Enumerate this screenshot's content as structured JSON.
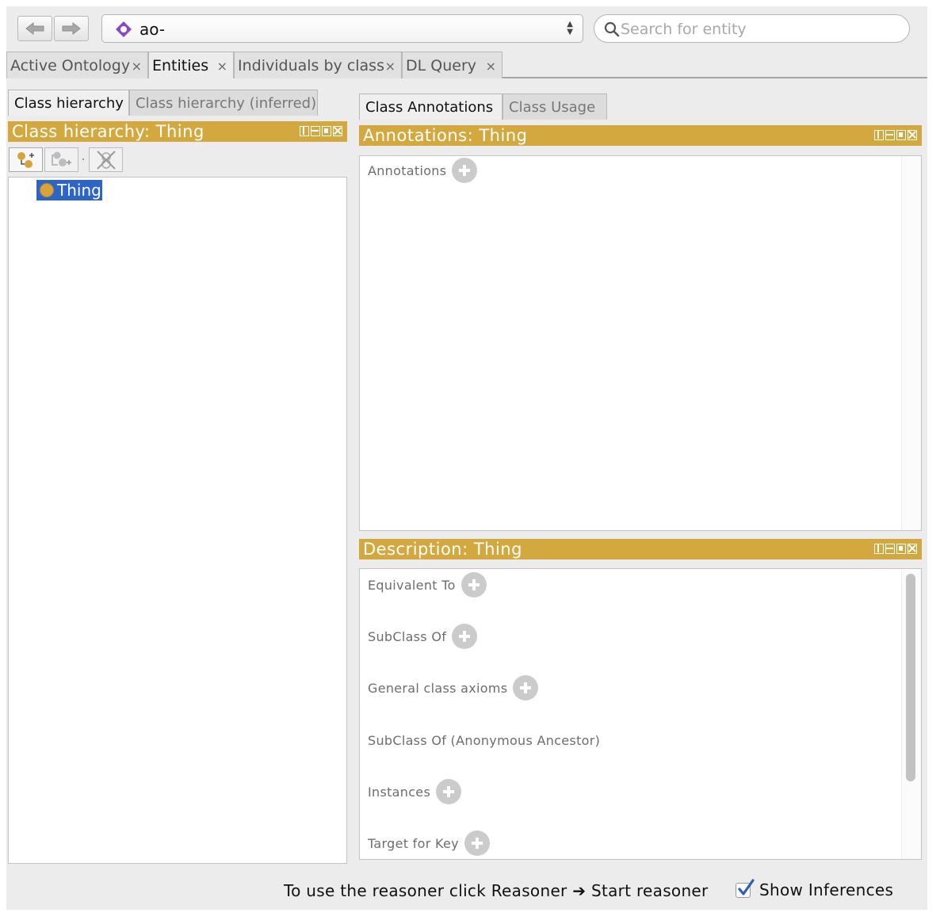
{
  "toolbar": {
    "back_icon": "arrow-left-icon",
    "forward_icon": "arrow-right-icon",
    "ontology_selector": {
      "value": "ao-",
      "icon": "ontology-diamond-icon"
    },
    "search": {
      "placeholder": "Search for entity",
      "icon": "search-icon"
    }
  },
  "main_tabs": [
    {
      "label": "Active Ontology",
      "close": "×"
    },
    {
      "label": "Entities",
      "close": "×",
      "active": true
    },
    {
      "label": "Individuals by class",
      "close": "×"
    },
    {
      "label": "DL Query",
      "close": "×"
    }
  ],
  "left_panel": {
    "tabs": [
      {
        "label": "Class hierarchy",
        "active": true
      },
      {
        "label": "Class hierarchy (inferred)"
      }
    ],
    "view_title": "Class hierarchy: Thing",
    "tools": [
      "add-subclass-icon",
      "add-sibling-class-icon",
      "delete-class-icon"
    ],
    "tree": [
      {
        "label": "Thing",
        "selected": true
      }
    ]
  },
  "right_panel": {
    "tabs": [
      {
        "label": "Class Annotations",
        "active": true
      },
      {
        "label": "Class Usage"
      }
    ],
    "annotations_view": {
      "title": "Annotations: Thing",
      "sections": [
        {
          "label": "Annotations",
          "addable": true
        }
      ]
    },
    "description_view": {
      "title": "Description: Thing",
      "sections": [
        {
          "label": "Equivalent To",
          "addable": true
        },
        {
          "label": "SubClass Of",
          "addable": true
        },
        {
          "label": "General class axioms",
          "addable": true
        },
        {
          "label": "SubClass Of (Anonymous Ancestor)",
          "addable": false
        },
        {
          "label": "Instances",
          "addable": true
        },
        {
          "label": "Target for Key",
          "addable": true
        }
      ]
    }
  },
  "status_bar": {
    "message": "To use the reasoner click Reasoner ➔ Start reasoner",
    "show_inferences": {
      "label": "Show Inferences",
      "checked": true
    }
  },
  "colors": {
    "view_header": "#d3a83f",
    "selection": "#2d64c8",
    "class_dot": "#d6a43a",
    "ontology_icon": "#8b47c4",
    "checkbox": "#2b5fb8"
  }
}
